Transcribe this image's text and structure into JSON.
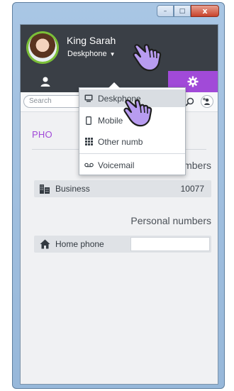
{
  "window": {
    "minimize": "–",
    "maximize": "□",
    "close": "x"
  },
  "user": {
    "name": "King Sarah",
    "status": "Deskphone"
  },
  "search": {
    "placeholder": "Search"
  },
  "section": {
    "title": "PHO"
  },
  "professional": {
    "heading": "Professional numbers",
    "business_label": "Business",
    "business_value": "10077"
  },
  "personal": {
    "heading": "Personal numbers",
    "home_label": "Home phone"
  },
  "dropdown": {
    "items": [
      "Deskphone",
      "Mobile",
      "Other numb",
      "Voicemail"
    ]
  },
  "colors": {
    "accent": "#a14ad8",
    "header": "#3a3f46",
    "avatar_ring": "#7bbf38"
  }
}
